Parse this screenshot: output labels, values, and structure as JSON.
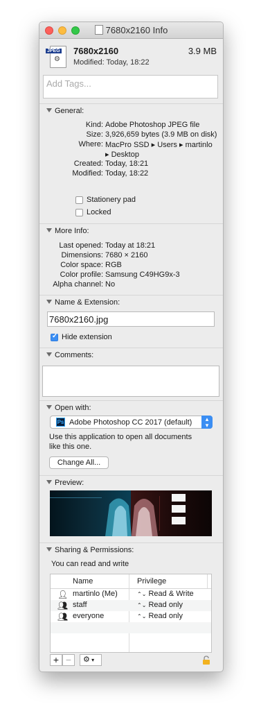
{
  "window": {
    "title": "7680x2160 Info"
  },
  "header": {
    "icon_label": "JPEG",
    "filename": "7680x2160",
    "size": "3.9 MB",
    "modified": "Modified: Today, 18:22"
  },
  "tags": {
    "placeholder": "Add Tags..."
  },
  "general": {
    "heading": "General:",
    "rows": [
      {
        "k": "Kind:",
        "v": "Adobe Photoshop JPEG file"
      },
      {
        "k": "Size:",
        "v": "3,926,659 bytes (3.9 MB on disk)"
      },
      {
        "k": "Where:",
        "v": "MacPro SSD ▸ Users ▸ martinlo"
      },
      {
        "k": "",
        "v": "▸ Desktop"
      },
      {
        "k": "Created:",
        "v": "Today, 18:21"
      },
      {
        "k": "Modified:",
        "v": "Today, 18:22"
      }
    ],
    "stationery_label": "Stationery pad",
    "locked_label": "Locked"
  },
  "more_info": {
    "heading": "More Info:",
    "rows": [
      {
        "k": "Last opened:",
        "v": "Today at 18:21"
      },
      {
        "k": "Dimensions:",
        "v": "7680 × 2160"
      },
      {
        "k": "Color space:",
        "v": "RGB"
      },
      {
        "k": "Color profile:",
        "v": "Samsung C49HG9x-3"
      },
      {
        "k": "Alpha channel:",
        "v": "No"
      }
    ]
  },
  "name_ext": {
    "heading": "Name & Extension:",
    "value": "7680x2160.jpg",
    "hide_ext_label": "Hide extension",
    "hide_ext_checked": true
  },
  "comments": {
    "heading": "Comments:"
  },
  "open_with": {
    "heading": "Open with:",
    "app_icon": "Ps",
    "app": "Adobe Photoshop CC 2017 (default)",
    "desc_line1": "Use this application to open all documents",
    "desc_line2": "like this one.",
    "change_all": "Change All..."
  },
  "preview": {
    "heading": "Preview:"
  },
  "sharing": {
    "heading": "Sharing & Permissions:",
    "status": "You can read and write",
    "col_name": "Name",
    "col_privilege": "Privilege",
    "rows": [
      {
        "name": "martinlo (Me)",
        "privilege": "Read & Write",
        "icon": "user-icon"
      },
      {
        "name": "staff",
        "privilege": "Read only",
        "icon": "group-icon"
      },
      {
        "name": "everyone",
        "privilege": "Read only",
        "icon": "everyone-icon"
      }
    ]
  },
  "colors": {
    "accent": "#3b8ef3",
    "lock": "#f2b21f"
  }
}
